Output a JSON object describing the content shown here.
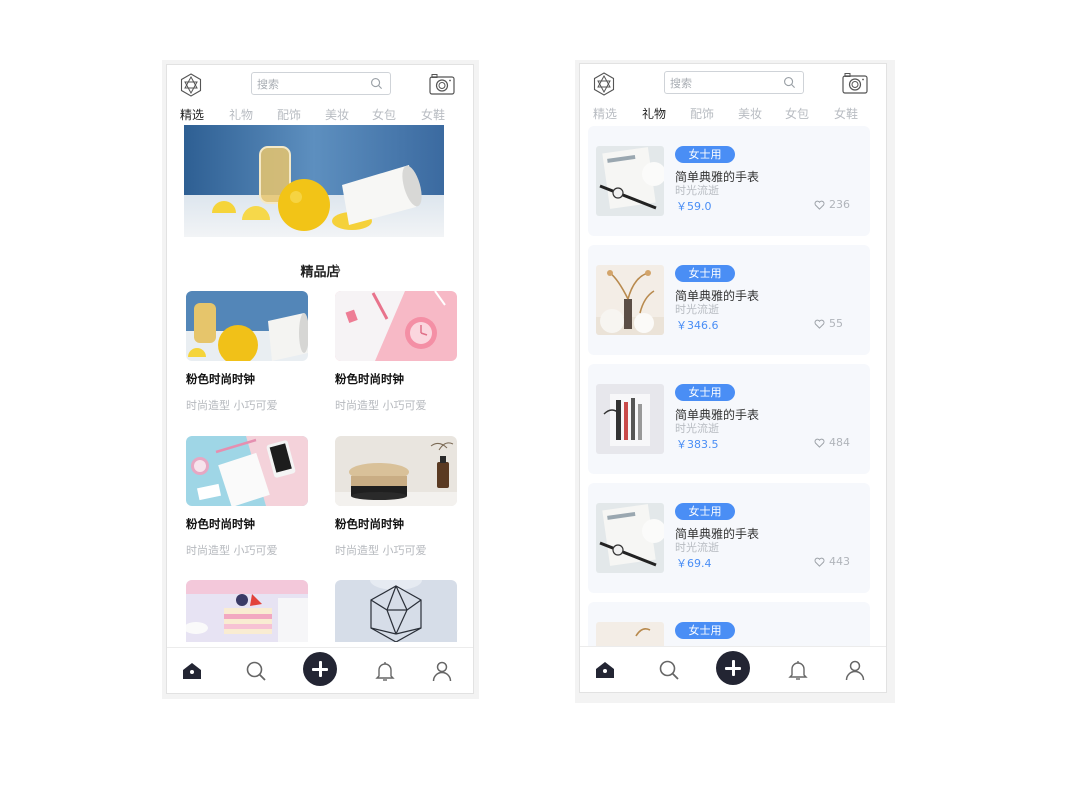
{
  "left_screen": {
    "search_placeholder": "搜索",
    "tabs": [
      "精选",
      "礼物",
      "配饰",
      "美妆",
      "女包",
      "女鞋"
    ],
    "active_tab": "精选",
    "section_title": "精品店",
    "section_chevron": "〉",
    "cards": [
      {
        "title": "粉色时尚时钟",
        "subtitle": "时尚造型 小巧可爱"
      },
      {
        "title": "粉色时尚时钟",
        "subtitle": "时尚造型 小巧可爱"
      },
      {
        "title": "粉色时尚时钟",
        "subtitle": "时尚造型 小巧可爱"
      },
      {
        "title": "粉色时尚时钟",
        "subtitle": "时尚造型 小巧可爱"
      }
    ]
  },
  "right_screen": {
    "search_placeholder": "搜索",
    "tabs": [
      "精选",
      "礼物",
      "配饰",
      "美妆",
      "女包",
      "女鞋"
    ],
    "active_tab": "礼物",
    "items": [
      {
        "badge": "女士用",
        "name": "简单典雅的手表",
        "sub": "时光流逝",
        "price": "￥59.0",
        "likes": "236"
      },
      {
        "badge": "女士用",
        "name": "简单典雅的手表",
        "sub": "时光流逝",
        "price": "￥346.6",
        "likes": "55"
      },
      {
        "badge": "女士用",
        "name": "简单典雅的手表",
        "sub": "时光流逝",
        "price": "￥383.5",
        "likes": "484"
      },
      {
        "badge": "女士用",
        "name": "简单典雅的手表",
        "sub": "时光流逝",
        "price": "￥69.4",
        "likes": "443"
      },
      {
        "badge": "女士用"
      }
    ]
  },
  "colors": {
    "accent": "#4a8ef5",
    "nav_dark": "#232533",
    "card_bg": "#f6f8fc"
  }
}
